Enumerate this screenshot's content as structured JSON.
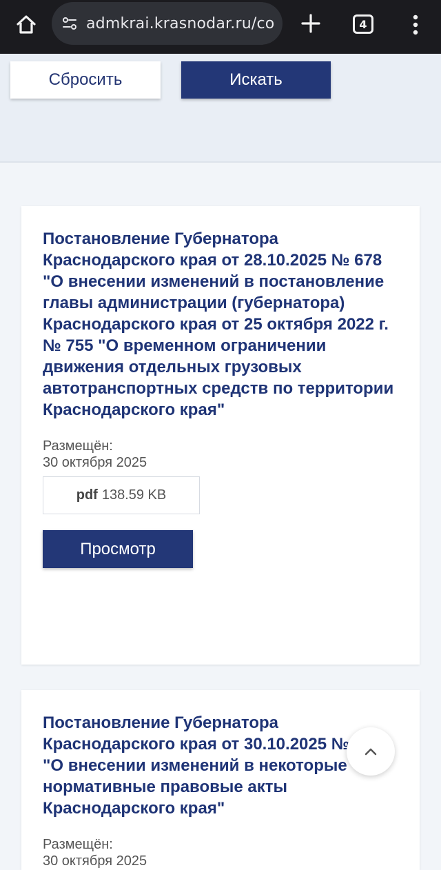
{
  "browser": {
    "url": "admkrai.krasnodar.ru/co",
    "tab_count": "4",
    "icons": [
      "home-icon",
      "site-settings-icon",
      "plus-icon",
      "tab-switcher-icon",
      "more-vert-icon"
    ]
  },
  "filter": {
    "reset_label": "Сбросить",
    "search_label": "Искать"
  },
  "documents": [
    {
      "title": "Постановление Губернатора Краснодарского края от 28.10.2025 № 678 \"О внесении изменений в постановление главы администрации (губернатора) Краснодарского края от 25 октября 2022 г. № 755 \"О временном ограничении движения отдельных грузовых автотранспортных средств по территории Краснодарского края\"",
      "placed_label": "Размещён:",
      "placed_date": "30 октября 2025",
      "file_ext": "pdf",
      "file_size": "138.59 KB",
      "view_label": "Просмотр"
    },
    {
      "title": "Постановление Губернатора Краснодарского края от 30.10.2025 № 684 \"О внесении изменений в некоторые нормативные правовые акты Краснодарского края\"",
      "placed_label": "Размещён:",
      "placed_date": "30 октября 2025"
    }
  ],
  "colors": {
    "accent": "#233777",
    "title": "#1f3476",
    "page_bg": "#f2f5f9",
    "browser_bar": "#1b1b1f"
  }
}
